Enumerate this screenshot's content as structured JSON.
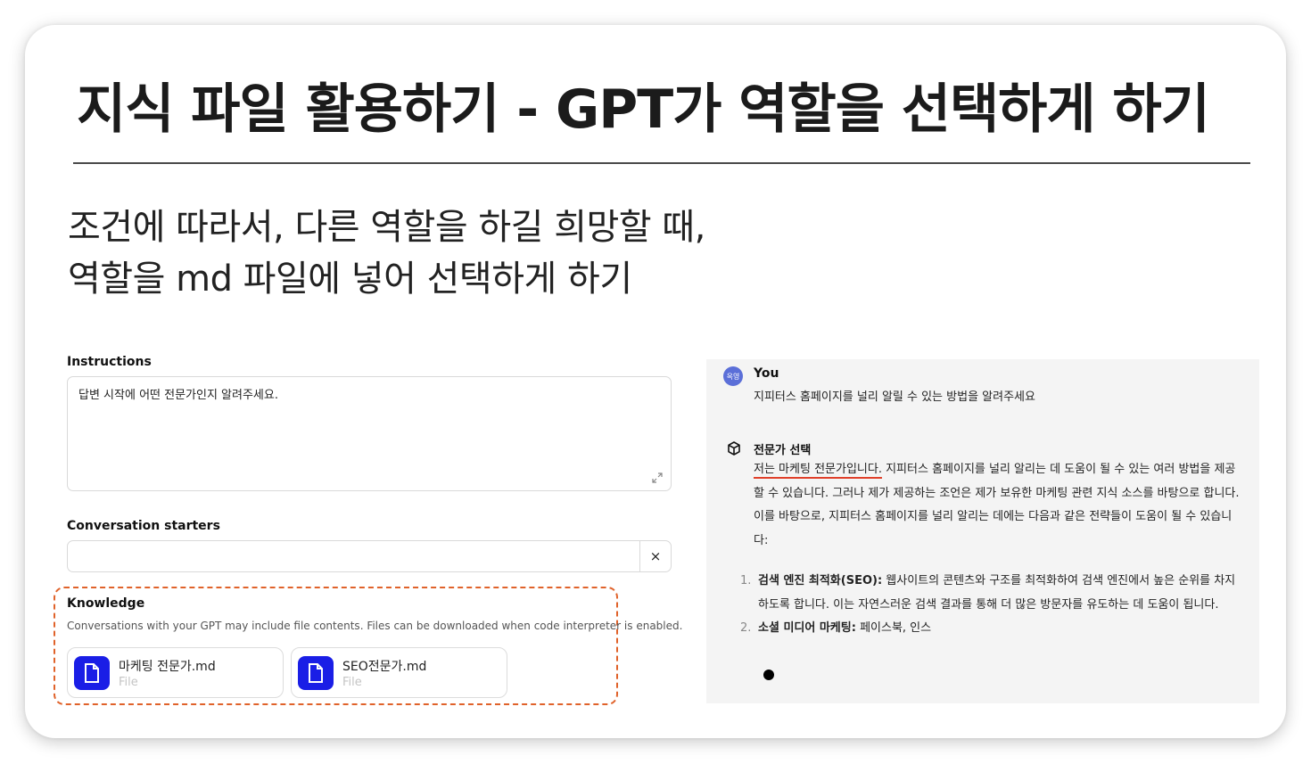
{
  "slide": {
    "title": "지식 파일 활용하기 - GPT가 역할을 선택하게 하기",
    "subtitle_line1": "조건에 따라서, 다른 역할을 하길 희망할 때,",
    "subtitle_line2": "역할을 md 파일에 넣어 선택하게 하기"
  },
  "form": {
    "instructions_label": "Instructions",
    "instructions_value": "답변 시작에 어떤 전문가인지 알려주세요.",
    "starters_label": "Conversation starters",
    "starters_value": "",
    "clear_icon": "×",
    "knowledge_label": "Knowledge",
    "knowledge_desc": "Conversations with your GPT may include file contents. Files can be downloaded when code interpreter is enabled.",
    "files": [
      {
        "name": "마케팅 전문가.md",
        "type": "File"
      },
      {
        "name": "SEO전문가.md",
        "type": "File"
      }
    ]
  },
  "chat": {
    "user_avatar": "옥영",
    "user_name": "You",
    "user_message": "지피터스 홈페이지를 널리 알릴 수 있는 방법을 알려주세요",
    "gpt_name": "전문가 선택",
    "gpt_highlight": "저는 마케팅 전문가입니다.",
    "gpt_rest": " 지피터스 홈페이지를 널리 알리는 데 도움이 될 수 있는 여러 방법을 제공할 수 있습니다. 그러나 제가 제공하는 조언은 제가 보유한 마케팅 관련 지식 소스를 바탕으로 합니다. 이를 바탕으로, 지피터스 홈페이지를 널리 알리는 데에는 다음과 같은 전략들이 도움이 될 수 있습니다:",
    "list": [
      {
        "num": "1.",
        "title": "검색 엔진 최적화(SEO):",
        "text": " 웹사이트의 콘텐츠와 구조를 최적화하여 검색 엔진에서 높은 순위를 차지하도록 합니다. 이는 자연스러운 검색 결과를 통해 더 많은 방문자를 유도하는 데 도움이 됩니다."
      },
      {
        "num": "2.",
        "title": "소셜 미디어 마케팅:",
        "text": " 페이스북, 인스"
      }
    ]
  }
}
